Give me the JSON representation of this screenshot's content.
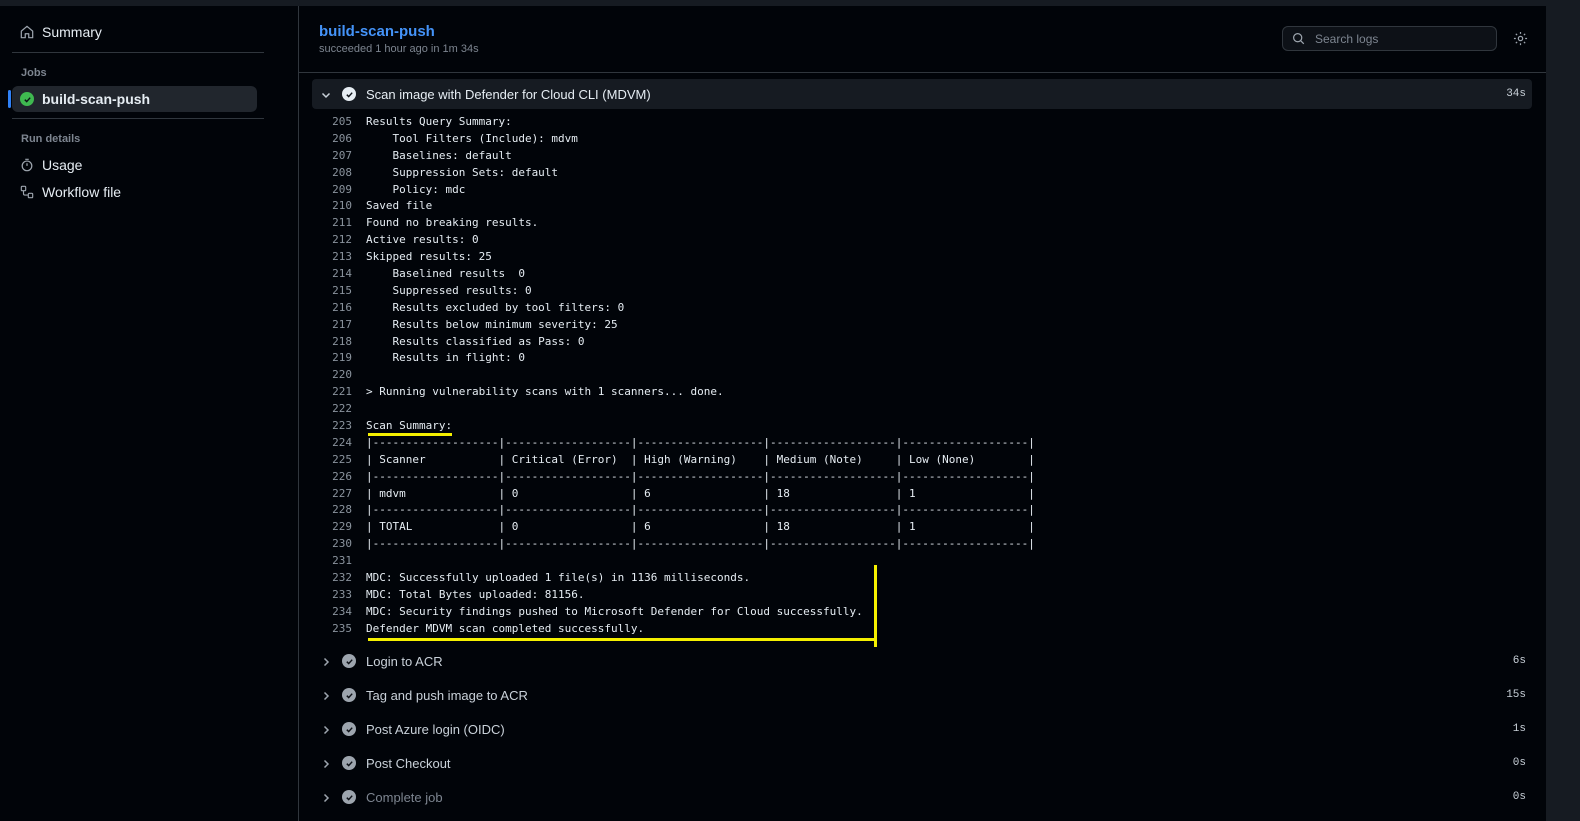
{
  "sidebar": {
    "summary_label": "Summary",
    "jobs_heading": "Jobs",
    "job_name": "build-scan-push",
    "run_details_heading": "Run details",
    "usage_label": "Usage",
    "workflow_label": "Workflow file"
  },
  "header": {
    "title": "build-scan-push",
    "subtitle": "succeeded 1 hour ago in 1m 34s",
    "search_placeholder": "Search logs"
  },
  "open_step": {
    "label": "Scan image with Defender for Cloud CLI (MDVM)",
    "duration": "34s"
  },
  "log_lines": [
    {
      "n": "205",
      "t": "Results Query Summary:"
    },
    {
      "n": "206",
      "t": "    Tool Filters (Include): mdvm"
    },
    {
      "n": "207",
      "t": "    Baselines: default"
    },
    {
      "n": "208",
      "t": "    Suppression Sets: default"
    },
    {
      "n": "209",
      "t": "    Policy: mdc"
    },
    {
      "n": "210",
      "t": "Saved file"
    },
    {
      "n": "211",
      "t": "Found no breaking results."
    },
    {
      "n": "212",
      "t": "Active results: 0"
    },
    {
      "n": "213",
      "t": "Skipped results: 25"
    },
    {
      "n": "214",
      "t": "    Baselined results  0"
    },
    {
      "n": "215",
      "t": "    Suppressed results: 0"
    },
    {
      "n": "216",
      "t": "    Results excluded by tool filters: 0"
    },
    {
      "n": "217",
      "t": "    Results below minimum severity: 25"
    },
    {
      "n": "218",
      "t": "    Results classified as Pass: 0"
    },
    {
      "n": "219",
      "t": "    Results in flight: 0"
    },
    {
      "n": "220",
      "t": ""
    },
    {
      "n": "221",
      "t": "> Running vulnerability scans with 1 scanners... done."
    },
    {
      "n": "222",
      "t": ""
    },
    {
      "n": "223",
      "t": "Scan Summary:"
    },
    {
      "n": "224",
      "t": "|-------------------|-------------------|-------------------|-------------------|-------------------|"
    },
    {
      "n": "225",
      "t": "| Scanner           | Critical (Error)  | High (Warning)    | Medium (Note)     | Low (None)        |"
    },
    {
      "n": "226",
      "t": "|-------------------|-------------------|-------------------|-------------------|-------------------|"
    },
    {
      "n": "227",
      "t": "| mdvm              | 0                 | 6                 | 18                | 1                 |"
    },
    {
      "n": "228",
      "t": "|-------------------|-------------------|-------------------|-------------------|-------------------|"
    },
    {
      "n": "229",
      "t": "| TOTAL             | 0                 | 6                 | 18                | 1                 |"
    },
    {
      "n": "230",
      "t": "|-------------------|-------------------|-------------------|-------------------|-------------------|"
    },
    {
      "n": "231",
      "t": ""
    },
    {
      "n": "232",
      "t": "MDC: Successfully uploaded 1 file(s) in 1136 milliseconds."
    },
    {
      "n": "233",
      "t": "MDC: Total Bytes uploaded: 81156."
    },
    {
      "n": "234",
      "t": "MDC: Security findings pushed to Microsoft Defender for Cloud successfully."
    },
    {
      "n": "235",
      "t": "Defender MDVM scan completed successfully."
    }
  ],
  "steps": [
    {
      "label": "Login to ACR",
      "duration": "6s"
    },
    {
      "label": "Tag and push image to ACR",
      "duration": "15s"
    },
    {
      "label": "Post Azure login (OIDC)",
      "duration": "1s"
    },
    {
      "label": "Post Checkout",
      "duration": "0s"
    },
    {
      "label": "Complete job",
      "duration": "0s"
    }
  ],
  "colors": {
    "accent": "#4493f8",
    "success": "#3fb950",
    "highlight": "#f5f000"
  }
}
